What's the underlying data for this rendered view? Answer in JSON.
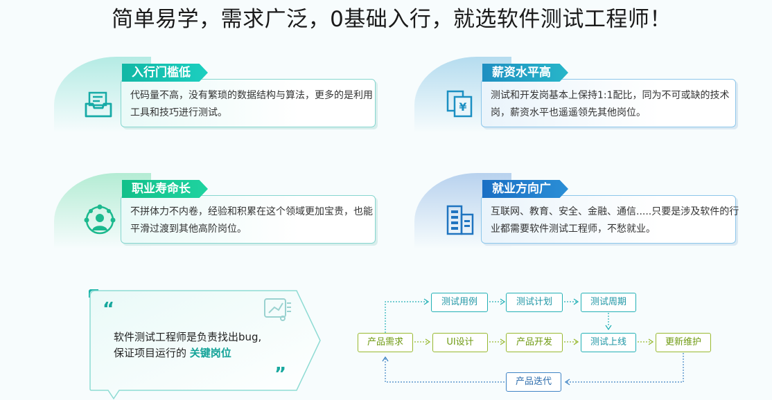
{
  "headline": "简单易学，需求广泛，0基础入行，就选软件测试工程师！",
  "cards": [
    {
      "title": "入行门槛低",
      "desc": "代码量不高，没有繁琐的数据结构与算法，更多的是利用工具和技巧进行测试。",
      "icon": "inbox-tray-icon"
    },
    {
      "title": "薪资水平高",
      "desc": "测试和开发岗基本上保持1:1配比，同为不可或缺的技术岗，薪资水平也遥遥领先其他岗位。",
      "icon": "yen-document-icon"
    },
    {
      "title": "职业寿命长",
      "desc": "不拼体力不内卷，经验和积累在这个领域更加宝贵，也能平滑过渡到其他高阶岗位。",
      "icon": "network-person-icon"
    },
    {
      "title": "就业方向广",
      "desc": "互联网、教育、安全、金融、通信.....只要是涉及软件的行业都需要软件测试工程师，不愁就业。",
      "icon": "buildings-icon"
    }
  ],
  "quote": {
    "open_mark": "“",
    "close_mark": "”",
    "line1": "软件测试工程师是负责找出bug,",
    "line2_prefix": "保证项目运行的",
    "line2_highlight": "关键岗位",
    "icon": "circuit-board-icon"
  },
  "flow": {
    "product_requirement": "产品需求",
    "ui_design": "UI设计",
    "product_dev": "产品开发",
    "test_launch": "测试上线",
    "update_maintain": "更新维护",
    "test_case": "测试用例",
    "test_plan": "测试计划",
    "test_cycle": "测试周期",
    "product_iteration": "产品迭代"
  },
  "colors": {
    "teal": "#19b3a8",
    "blue": "#1f7cc4",
    "green": "#2ec48a",
    "flow_teal": "#22b0b5",
    "flow_green": "#97b82e",
    "flow_blue": "#3e83c4"
  }
}
